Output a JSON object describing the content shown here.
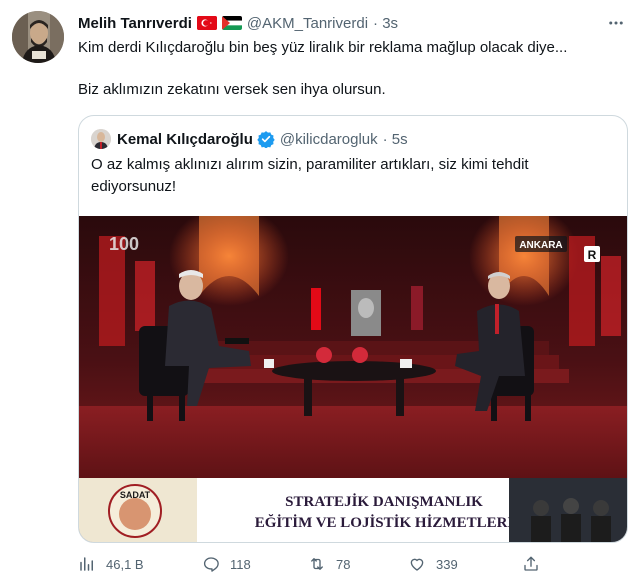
{
  "tweet": {
    "author_name": "Melih Tanrıverdi",
    "handle": "@AKM_Tanriverdi",
    "time": "· 3s",
    "text_line1": "Kim derdi Kılıçdaroğlu bin beş yüz liralık bir reklama mağlup olacak diye...",
    "text_line2": "Biz aklımızın zekatını versek sen ihya olursun."
  },
  "quoted": {
    "author_name": "Kemal Kılıçdaroğlu",
    "handle": "@kilicdarogluk",
    "time": "· 5s",
    "text": "O az kalmış aklınızı alırım sizin, paramiliter artıkları, siz kimi tehdit ediyorsunuz!"
  },
  "media": {
    "channel_logo": "100",
    "location_tag": "ANKARA",
    "corner_logo": "R",
    "ad_logo": "SADAT",
    "ad_line1": "STRATEJİK DANIŞMANLIK",
    "ad_line2": "EĞİTİM VE LOJİSTİK HİZMETLERİ"
  },
  "actions": {
    "views": "46,1 B",
    "replies": "118",
    "retweets": "78",
    "likes": "339"
  },
  "colors": {
    "text": "#0f1419",
    "secondary": "#536471",
    "border": "#cfd9de",
    "verified": "#1d9bf0"
  },
  "icons": [
    "more-icon",
    "turkey-flag-icon",
    "palestine-flag-icon",
    "verified-badge-icon",
    "views-icon",
    "reply-icon",
    "retweet-icon",
    "like-icon",
    "share-icon"
  ]
}
